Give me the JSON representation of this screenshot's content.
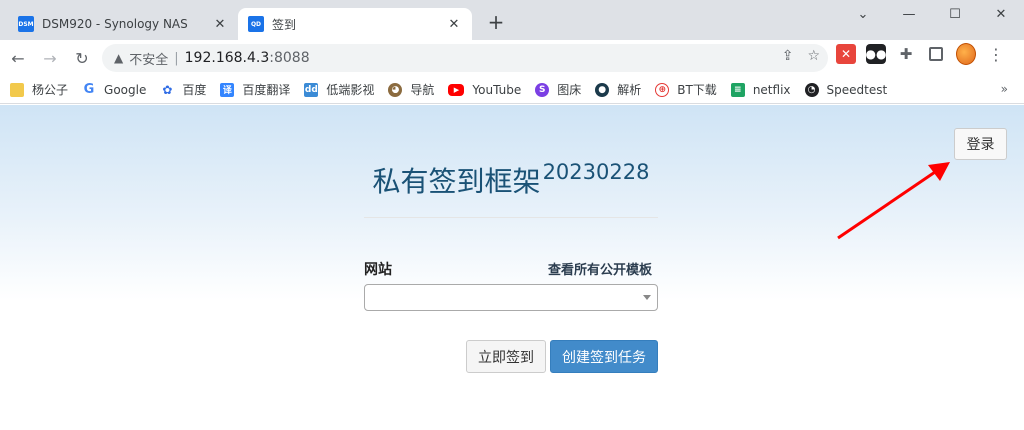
{
  "browser": {
    "tabs": [
      {
        "title": "DSM920 - Synology NAS",
        "favicon": "DSM",
        "favicon_color": "#1a73e8",
        "active": false
      },
      {
        "title": "签到",
        "favicon": "QD",
        "favicon_color": "#1a73e8",
        "active": true
      }
    ],
    "new_tab_icon": "plus-icon",
    "window_controls": [
      "minimize",
      "maximize",
      "close"
    ],
    "address": {
      "security_label": "不安全",
      "host": "192.168.4.3",
      "port": ":8088"
    },
    "bookmarks": [
      {
        "label": "杨公子",
        "icon": "folder-icon",
        "color": "#f2c94c"
      },
      {
        "label": "Google",
        "icon": "google-icon",
        "color": "#4285f4"
      },
      {
        "label": "百度",
        "icon": "baidu-paw-icon",
        "color": "#2f6ce5"
      },
      {
        "label": "百度翻译",
        "icon": "translate-icon",
        "color": "#3385ff"
      },
      {
        "label": "低端影视",
        "icon": "dd-icon",
        "color": "#3b8bd6"
      },
      {
        "label": "导航",
        "icon": "owl-icon",
        "color": "#8b6b3f"
      },
      {
        "label": "YouTube",
        "icon": "youtube-icon",
        "color": "#ff0000"
      },
      {
        "label": "图床",
        "icon": "image-host-icon",
        "color": "#7b3fe4"
      },
      {
        "label": "解析",
        "icon": "globe-icon",
        "color": "#1b3a4b"
      },
      {
        "label": "BT下载",
        "icon": "bt-icon",
        "color": "#e53935"
      },
      {
        "label": "netflix",
        "icon": "netflix-icon",
        "color": "#1fa463"
      },
      {
        "label": "Speedtest",
        "icon": "speedtest-icon",
        "color": "#202124"
      }
    ],
    "bookmarks_more": "»"
  },
  "page": {
    "login_label": "登录",
    "title": "私有签到框架",
    "version": "20230228",
    "site_label": "网站",
    "template_link": "查看所有公开模板",
    "site_select_value": "",
    "checkin_now_label": "立即签到",
    "create_task_label": "创建签到任务"
  },
  "colors": {
    "primary_button": "#428bca",
    "heading": "#1a5276",
    "annotation_arrow": "#ff0000"
  }
}
